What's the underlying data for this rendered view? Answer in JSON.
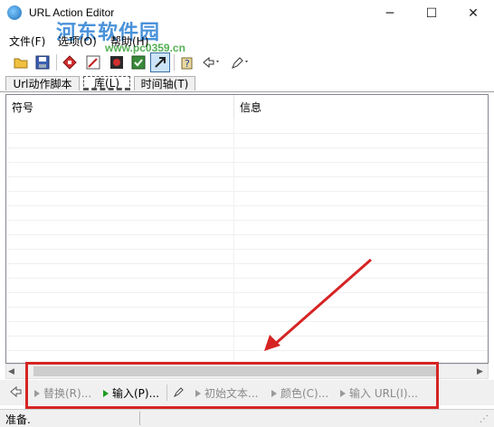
{
  "window": {
    "title": "URL Action Editor",
    "minimize": "─",
    "maximize": "☐",
    "close": "✕"
  },
  "watermark": {
    "text": "河东软件园",
    "url": "www.pc0359.cn"
  },
  "menu": [
    {
      "label": "文件(F)"
    },
    {
      "label": "选项(O)"
    },
    {
      "label": "帮助(H)"
    }
  ],
  "toolbar": {
    "icons": [
      "open-folder-icon",
      "save-icon",
      "stop-icon",
      "edit-icon",
      "record-icon",
      "check-icon",
      "arrow-icon",
      "help-icon",
      "pointer-icon",
      "pen-icon"
    ]
  },
  "tabs": [
    {
      "label": "Url动作脚本"
    },
    {
      "label": "库(L)"
    },
    {
      "label": "时间轴(T)"
    }
  ],
  "list": {
    "columns": [
      "符号",
      "信息"
    ]
  },
  "bottom_bar": {
    "replace": "替换(R)...",
    "input": "输入(P)...",
    "initial_text": "初始文本...",
    "color": "颜色(C)...",
    "input_url": "输入 URL(I)..."
  },
  "status": {
    "text": "准备."
  },
  "colors": {
    "highlight": "#d62424",
    "accent": "#1c9c1c"
  }
}
